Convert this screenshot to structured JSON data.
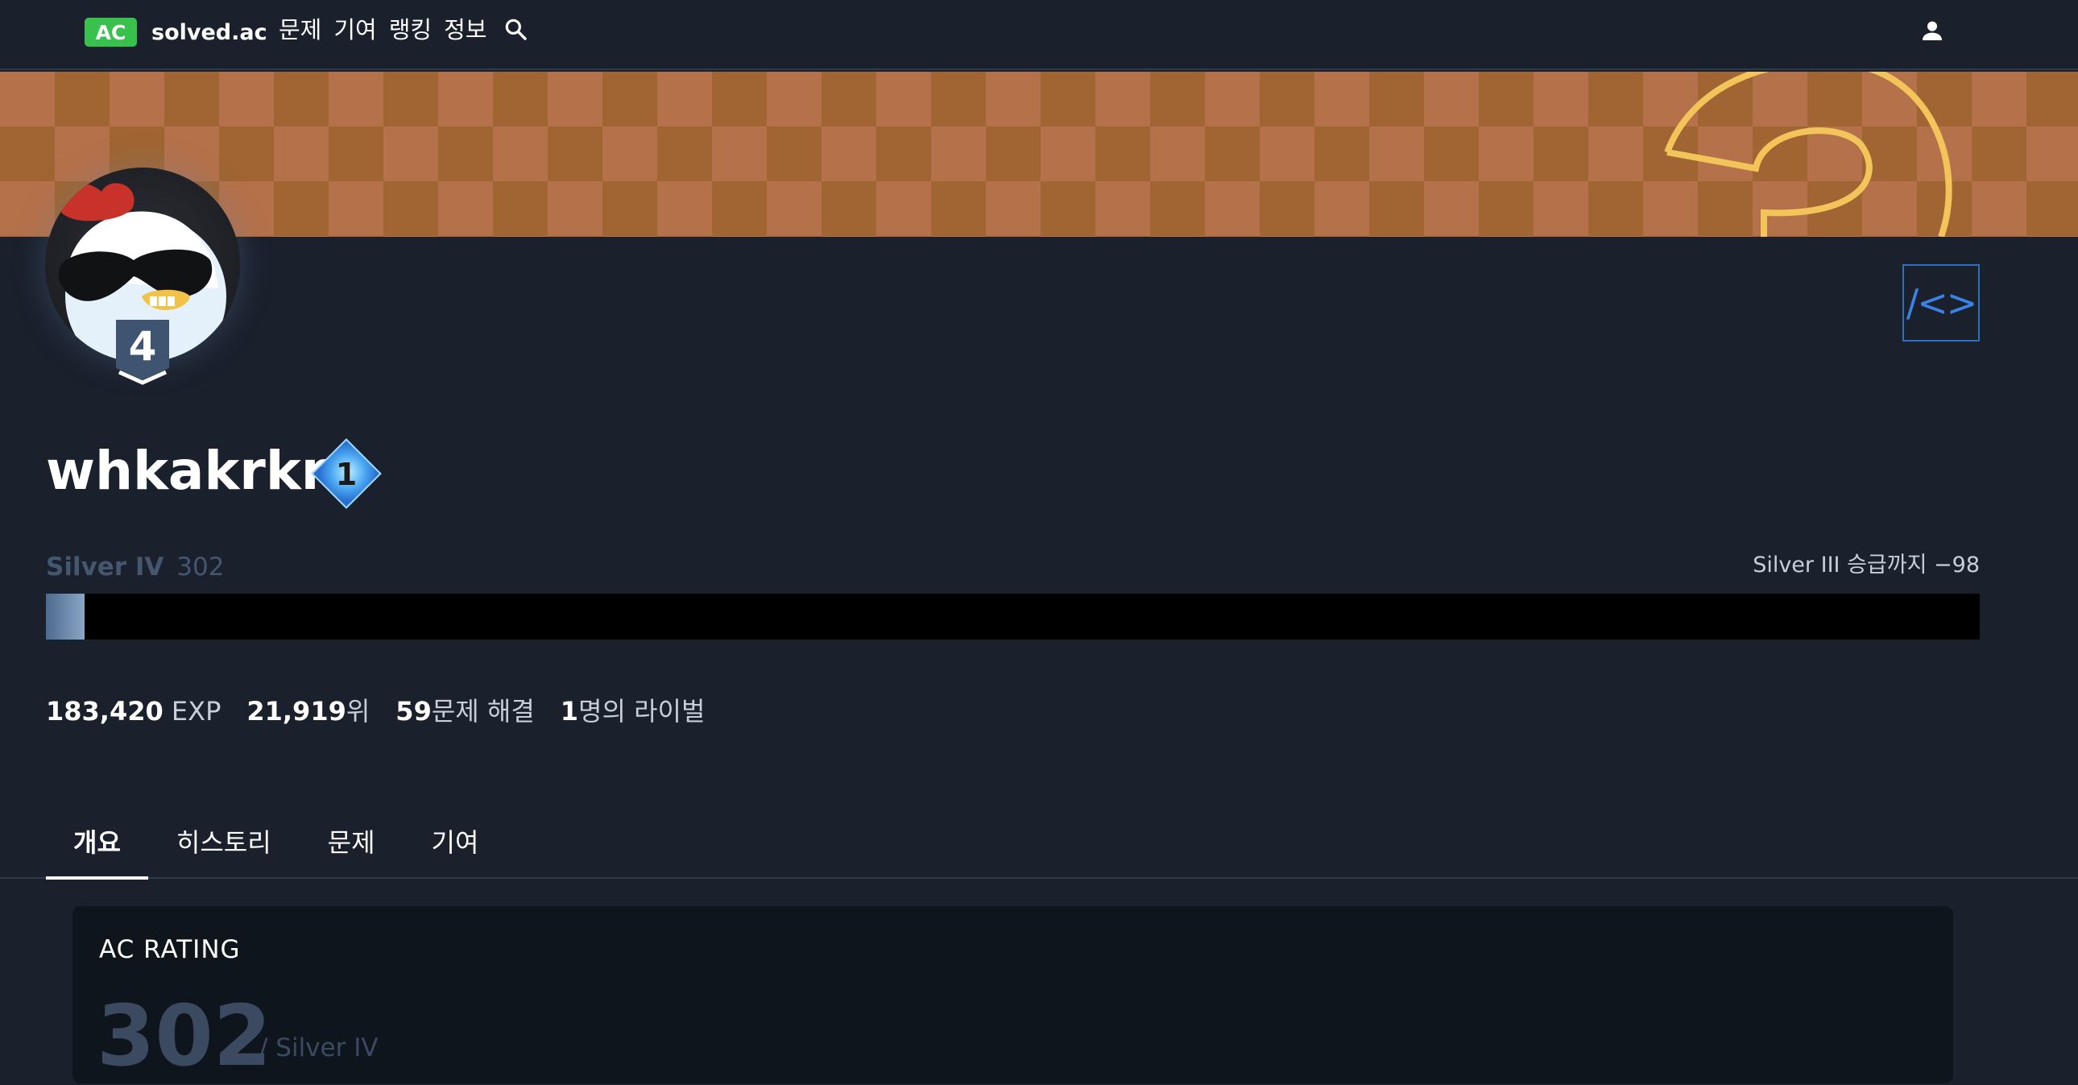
{
  "nav": {
    "brand_badge": "AC",
    "brand_name": "solved.ac",
    "links": [
      "문제",
      "기여",
      "랭킹",
      "정보"
    ],
    "search_icon": "search-icon",
    "user_icon": "person-icon"
  },
  "profile": {
    "username": "whkakrkr",
    "level_badge": "4",
    "class_badge": "1",
    "embed_label": "/<>",
    "tier_name": "Silver IV",
    "rating": "302",
    "promotion_text": "Silver III 승급까지 −98",
    "progress_fraction": 0.02
  },
  "stats": {
    "exp_value": "183,420",
    "exp_unit": "EXP",
    "rank_value": "21,919",
    "rank_unit": "위",
    "solved_value": "59",
    "solved_unit": "문제 해결",
    "rivals_value": "1",
    "rivals_unit": "명의 라이벌"
  },
  "tabs": [
    "개요",
    "히스토리",
    "문제",
    "기여"
  ],
  "card": {
    "title": "AC RATING",
    "rating": "302",
    "tier": "/ Silver IV"
  },
  "colors": {
    "accent_green": "#38c24d",
    "silver_tier": "#45566f",
    "embed_blue": "#3b82e6"
  }
}
